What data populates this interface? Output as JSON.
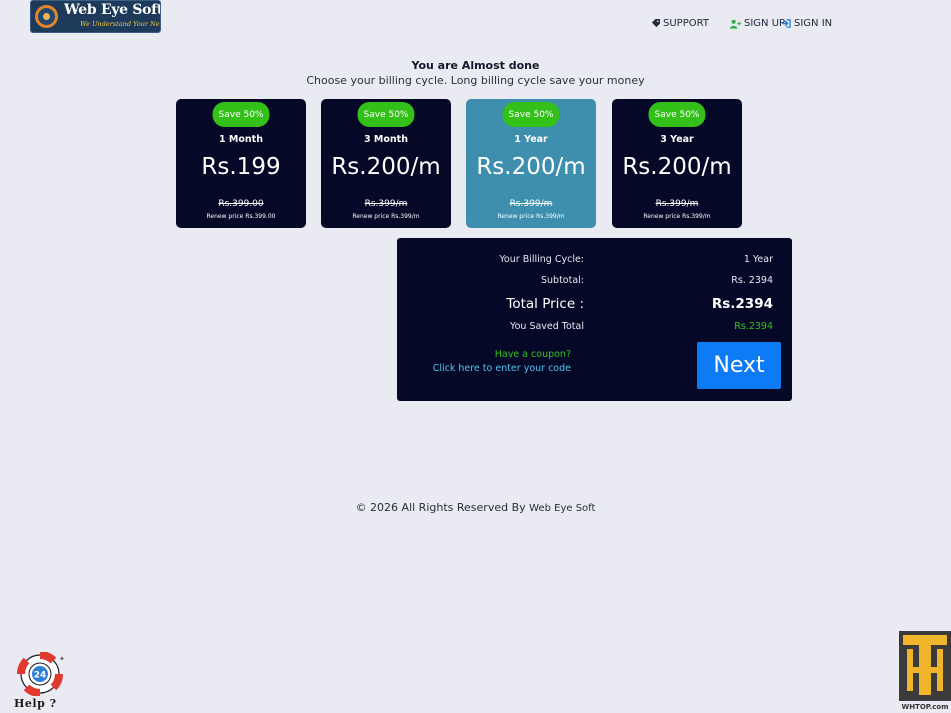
{
  "header": {
    "logo": {
      "title": "Web Eye Soft",
      "tagline": "We Understand Your Needs"
    },
    "nav": {
      "support": "SUPPORT",
      "signup": "SIGN UP",
      "signin": "SIGN IN"
    }
  },
  "intro": {
    "heading": "You are Almost done",
    "subheading": "Choose your billing cycle. Long billing cycle save your money"
  },
  "plans": [
    {
      "badge": "Save 50%",
      "cycle": "1 Month",
      "price": "Rs.199",
      "old_price": "Rs.399.00",
      "renew": "Renew price Rs.399.00",
      "selected": false
    },
    {
      "badge": "Save 50%",
      "cycle": "3 Month",
      "price": "Rs.200/m",
      "old_price": "Rs.399/m",
      "renew": "Renew price Rs.399/m",
      "selected": false
    },
    {
      "badge": "Save 50%",
      "cycle": "1 Year",
      "price": "Rs.200/m",
      "old_price": "Rs.399/m",
      "renew": "Renew price Rs.399/m",
      "selected": true
    },
    {
      "badge": "Save 50%",
      "cycle": "3 Year",
      "price": "Rs.200/m",
      "old_price": "Rs.399/m",
      "renew": "Renew price Rs.399/m",
      "selected": false
    }
  ],
  "summary": {
    "billing_label": "Your Billing Cycle:",
    "billing_value": "1 Year",
    "subtotal_label": "Subtotal:",
    "subtotal_value": "Rs. 2394",
    "total_label": "Total Price :",
    "total_value": "Rs.2394",
    "saved_label": "You Saved Total",
    "saved_value": "Rs.2394",
    "coupon_question": "Have a coupon?",
    "coupon_link": "Click here to enter your code",
    "next_label": "Next"
  },
  "footer": {
    "copyright": "© 2026 All Rights Reserved By",
    "brand": "Web Eye Soft"
  },
  "help_widget": {
    "label": "Help ?",
    "badge": "24"
  },
  "watermark": {
    "text": "WHTOP.com"
  },
  "colors": {
    "page_bg": "#e9eaf2",
    "card_bg": "#050927",
    "card_selected_bg": "#3e8fad",
    "badge_green": "#33c019",
    "next_blue": "#0d7bf5",
    "link_cyan": "#4fc4ec"
  },
  "icons": {
    "support": "ticket-icon",
    "signup": "user-plus-icon",
    "signin": "sign-in-icon",
    "help": "lifebuoy-24-icon"
  }
}
